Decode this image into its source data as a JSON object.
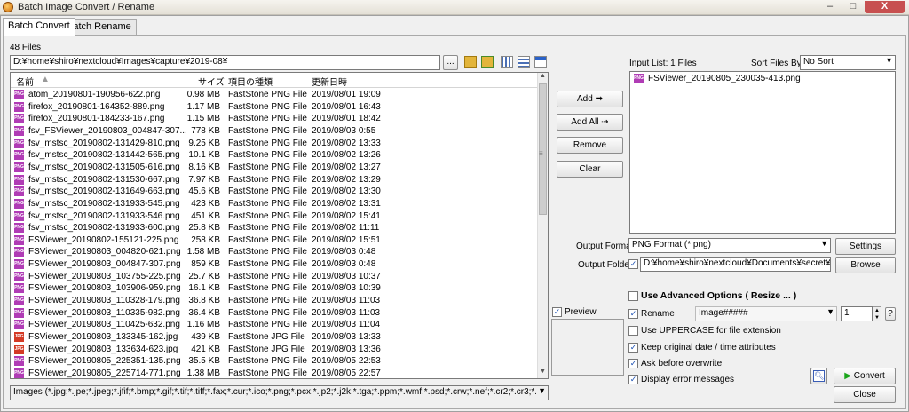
{
  "window": {
    "title": "Batch Image Convert / Rename",
    "minimize": "–",
    "maximize": "□",
    "close": "X"
  },
  "tabs": [
    {
      "label": "Batch Convert"
    },
    {
      "label": "Batch Rename"
    }
  ],
  "file_count": "48 Files",
  "path": {
    "value": "D:¥home¥shiro¥nextcloud¥Images¥capture¥2019-08¥",
    "browse": "..."
  },
  "columns": {
    "name": "名前",
    "size": "サイズ",
    "type": "項目の種類",
    "date": "更新日時"
  },
  "files": [
    {
      "icon": "png",
      "name": "atom_20190801-190956-622.png",
      "size": "0.98 MB",
      "type": "FastStone PNG File",
      "date": "2019/08/01 19:09"
    },
    {
      "icon": "png",
      "name": "firefox_20190801-164352-889.png",
      "size": "1.17 MB",
      "type": "FastStone PNG File",
      "date": "2019/08/01 16:43"
    },
    {
      "icon": "png",
      "name": "firefox_20190801-184233-167.png",
      "size": "1.15 MB",
      "type": "FastStone PNG File",
      "date": "2019/08/01 18:42"
    },
    {
      "icon": "png",
      "name": "fsv_FSViewer_20190803_004847-307...",
      "size": "778 KB",
      "type": "FastStone PNG File",
      "date": "2019/08/03 0:55"
    },
    {
      "icon": "png",
      "name": "fsv_mstsc_20190802-131429-810.png",
      "size": "9.25 KB",
      "type": "FastStone PNG File",
      "date": "2019/08/02 13:33"
    },
    {
      "icon": "png",
      "name": "fsv_mstsc_20190802-131442-565.png",
      "size": "10.1 KB",
      "type": "FastStone PNG File",
      "date": "2019/08/02 13:26"
    },
    {
      "icon": "png",
      "name": "fsv_mstsc_20190802-131505-616.png",
      "size": "8.16 KB",
      "type": "FastStone PNG File",
      "date": "2019/08/02 13:27"
    },
    {
      "icon": "png",
      "name": "fsv_mstsc_20190802-131530-667.png",
      "size": "7.97 KB",
      "type": "FastStone PNG File",
      "date": "2019/08/02 13:29"
    },
    {
      "icon": "png",
      "name": "fsv_mstsc_20190802-131649-663.png",
      "size": "45.6 KB",
      "type": "FastStone PNG File",
      "date": "2019/08/02 13:30"
    },
    {
      "icon": "png",
      "name": "fsv_mstsc_20190802-131933-545.png",
      "size": "423 KB",
      "type": "FastStone PNG File",
      "date": "2019/08/02 13:31"
    },
    {
      "icon": "png",
      "name": "fsv_mstsc_20190802-131933-546.png",
      "size": "451 KB",
      "type": "FastStone PNG File",
      "date": "2019/08/02 15:41"
    },
    {
      "icon": "png",
      "name": "fsv_mstsc_20190802-131933-600.png",
      "size": "25.8 KB",
      "type": "FastStone PNG File",
      "date": "2019/08/02 11:11"
    },
    {
      "icon": "png",
      "name": "FSViewer_20190802-155121-225.png",
      "size": "258 KB",
      "type": "FastStone PNG File",
      "date": "2019/08/02 15:51"
    },
    {
      "icon": "png",
      "name": "FSViewer_20190803_004820-621.png",
      "size": "1.58 MB",
      "type": "FastStone PNG File",
      "date": "2019/08/03 0:48"
    },
    {
      "icon": "png",
      "name": "FSViewer_20190803_004847-307.png",
      "size": "859 KB",
      "type": "FastStone PNG File",
      "date": "2019/08/03 0:48"
    },
    {
      "icon": "png",
      "name": "FSViewer_20190803_103755-225.png",
      "size": "25.7 KB",
      "type": "FastStone PNG File",
      "date": "2019/08/03 10:37"
    },
    {
      "icon": "png",
      "name": "FSViewer_20190803_103906-959.png",
      "size": "16.1 KB",
      "type": "FastStone PNG File",
      "date": "2019/08/03 10:39"
    },
    {
      "icon": "png",
      "name": "FSViewer_20190803_110328-179.png",
      "size": "36.8 KB",
      "type": "FastStone PNG File",
      "date": "2019/08/03 11:03"
    },
    {
      "icon": "png",
      "name": "FSViewer_20190803_110335-982.png",
      "size": "36.4 KB",
      "type": "FastStone PNG File",
      "date": "2019/08/03 11:03"
    },
    {
      "icon": "png",
      "name": "FSViewer_20190803_110425-632.png",
      "size": "1.16 MB",
      "type": "FastStone PNG File",
      "date": "2019/08/03 11:04"
    },
    {
      "icon": "jpg",
      "name": "FSViewer_20190803_133345-162.jpg",
      "size": "439 KB",
      "type": "FastStone JPG File",
      "date": "2019/08/03 13:33"
    },
    {
      "icon": "jpg",
      "name": "FSViewer_20190803_133634-623.jpg",
      "size": "421 KB",
      "type": "FastStone JPG File",
      "date": "2019/08/03 13:36"
    },
    {
      "icon": "png",
      "name": "FSViewer_20190805_225351-135.png",
      "size": "35.5 KB",
      "type": "FastStone PNG File",
      "date": "2019/08/05 22:53"
    },
    {
      "icon": "png",
      "name": "FSViewer_20190805_225714-771.png",
      "size": "1.38 MB",
      "type": "FastStone PNG File",
      "date": "2019/08/05 22:57"
    }
  ],
  "filter": {
    "value": "Images (*.jpg;*.jpe;*.jpeg;*.jfif;*.bmp;*.gif;*.tif;*.tiff;*.fax;*.cur;*.ico;*.png;*.pcx;*.jp2;*.j2k;*.tga;*.ppm;*.wmf;*.psd;*.crw;*.nef;*.cr2;*.cr3;*.c"
  },
  "buttons": {
    "add": "Add",
    "add_all": "Add All",
    "remove": "Remove",
    "clear": "Clear",
    "settings": "Settings",
    "browse": "Browse",
    "convert": "Convert",
    "close": "Close"
  },
  "preview_label": "Preview",
  "input_list": {
    "label": "Input List:  1 Files",
    "items": [
      {
        "icon": "png",
        "name": "FSViewer_20190805_230035-413.png"
      }
    ]
  },
  "sort": {
    "label": "Sort Files By:",
    "value": "No Sort"
  },
  "output_format": {
    "label": "Output Format:",
    "value": "PNG Format (*.png)"
  },
  "output_folder": {
    "label": "Output Folder:",
    "value": "D:¥home¥shiro¥nextcloud¥Documents¥secret¥model¥"
  },
  "options": {
    "advanced": "Use Advanced Options ( Resize ... )",
    "rename": "Rename",
    "rename_pattern": "Image#####",
    "rename_start": "1",
    "uppercase": "Use UPPERCASE for file extension",
    "keep_date": "Keep original date / time attributes",
    "ask_overwrite": "Ask before overwrite",
    "display_errors": "Display error messages"
  },
  "help": "?"
}
